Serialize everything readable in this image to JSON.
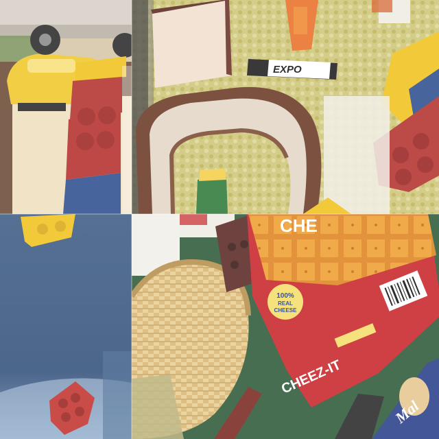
{
  "image": {
    "layout": "2x2 photo collage",
    "panels": [
      {
        "id": "top-left",
        "content": [
          "yellow-toy-car",
          "stacked-lego-duplo-bricks",
          "wooden-floor"
        ]
      },
      {
        "id": "top-right",
        "content": [
          "wooden-letter-o",
          "brown-block",
          "expo-marker",
          "orange-marker",
          "lego-duplo-bricks",
          "yellow-green-rug"
        ]
      },
      {
        "id": "bottom-left",
        "content": [
          "yellow-lego-brick",
          "red-lego-brick",
          "blue-surface"
        ]
      },
      {
        "id": "bottom-right",
        "content": [
          "woven-basket",
          "cheez-it-box",
          "brown-block",
          "cereal-box",
          "green-mat"
        ]
      }
    ]
  },
  "texts": {
    "marker_brand": "EXPO",
    "box_brand": "CHEEZ-IT",
    "box_badge_line1": "100%",
    "box_badge_line2": "REAL",
    "box_badge_line3": "CHEESE",
    "box_top_fragment": "CHE",
    "cereal_fragment": "Mal"
  },
  "colors": {
    "rug": "#cfc77a",
    "lego_red": "#b3322e",
    "lego_yellow": "#f1c21e",
    "lego_blue": "#2f4f8f",
    "cheezit_red": "#c8262a",
    "mat_green": "#2f5a3a",
    "blue_surface": "#3f5d86"
  }
}
